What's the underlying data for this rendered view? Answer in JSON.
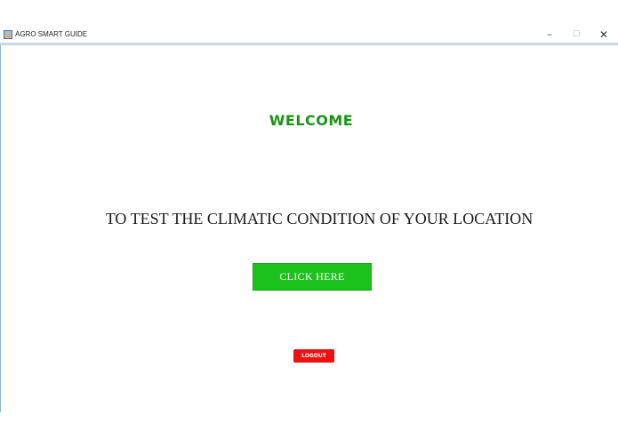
{
  "window": {
    "title": "AGRO SMART GUIDE",
    "minimize_glyph": "–",
    "maximize_glyph": "☐",
    "close_glyph": "✕",
    "icon": "java-app-icon"
  },
  "main": {
    "welcome": "WELCOME",
    "instruction": "TO TEST THE CLIMATIC CONDITION OF YOUR LOCATION",
    "click_button": "CLICK HERE",
    "logout_button": "LOGOUT"
  },
  "colors": {
    "welcome_text": "#1a9414",
    "click_button_bg": "#1cc21c",
    "logout_button_bg": "#ee1111"
  }
}
